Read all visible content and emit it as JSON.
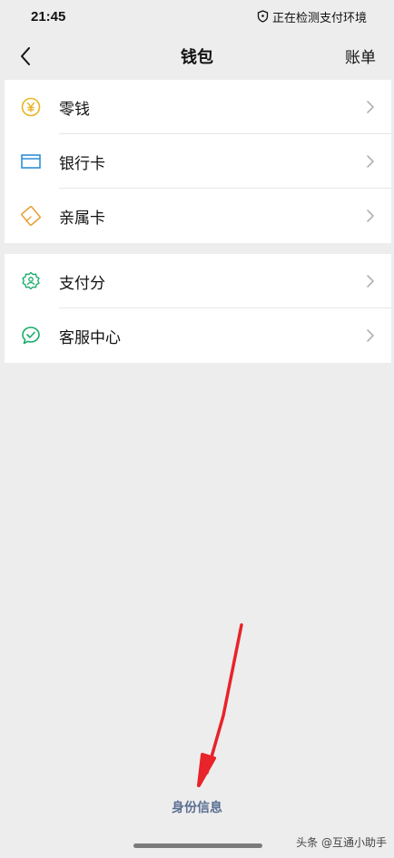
{
  "status_bar": {
    "time": "21:45",
    "notice": "正在检测支付环境",
    "notice_icon": "shield-icon"
  },
  "nav": {
    "back_icon": "chevron-left-icon",
    "title": "钱包",
    "action_label": "账单"
  },
  "groups": [
    {
      "items": [
        {
          "label": "零钱",
          "icon": "yuan-coin-icon",
          "icon_color": "#e9b422"
        },
        {
          "label": "银行卡",
          "icon": "bank-card-icon",
          "icon_color": "#2f8fd8"
        },
        {
          "label": "亲属卡",
          "icon": "family-card-icon",
          "icon_color": "#e6a23c"
        }
      ]
    },
    {
      "items": [
        {
          "label": "支付分",
          "icon": "pay-score-icon",
          "icon_color": "#1aad6a"
        },
        {
          "label": "客服中心",
          "icon": "customer-service-icon",
          "icon_color": "#1aad6a"
        }
      ]
    }
  ],
  "footer": {
    "identity_link": "身份信息"
  },
  "watermark": "头条 @互通小助手",
  "colors": {
    "background": "#ededed",
    "card": "#ffffff",
    "link": "#5a6f92",
    "arrow": "#e8232a"
  }
}
